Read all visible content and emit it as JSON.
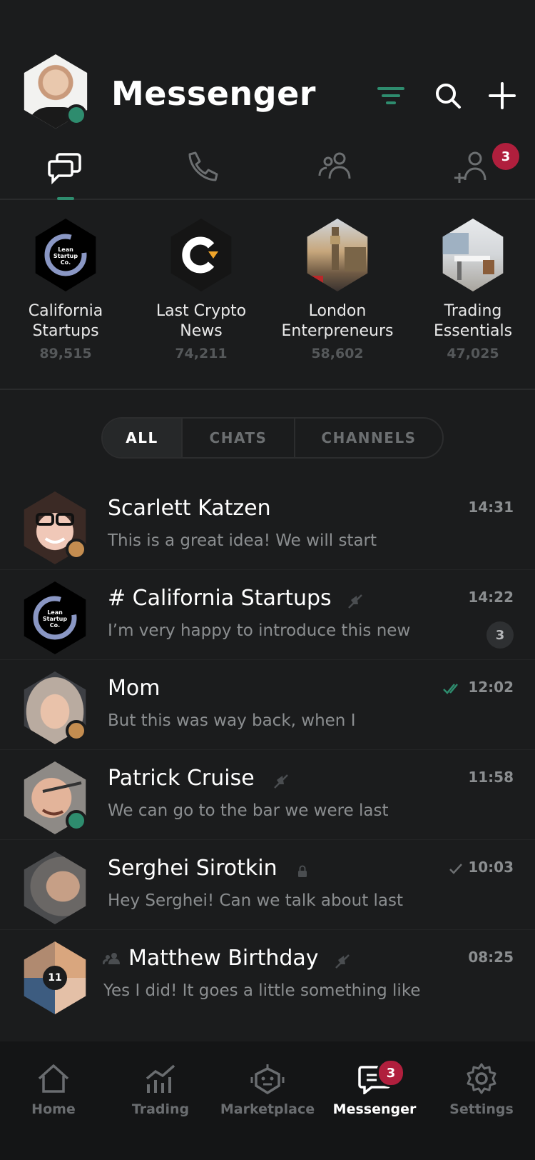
{
  "header": {
    "title": "Messenger",
    "contacts_badge": "3"
  },
  "featured": [
    {
      "name_line1": "California",
      "name_line2": "Startups",
      "count": "89,515"
    },
    {
      "name_line1": "Last Crypto",
      "name_line2": "News",
      "count": "74,211"
    },
    {
      "name_line1": "London",
      "name_line2": "Enterpreneurs",
      "count": "58,602"
    },
    {
      "name_line1": "Trading",
      "name_line2": "Essentials",
      "count": "47,025"
    }
  ],
  "filter_tabs": {
    "all": "ALL",
    "chats": "CHATS",
    "channels": "CHANNELS",
    "selected": "ALL"
  },
  "chats": [
    {
      "name": "Scarlett Katzen",
      "message": "This is a great idea! We will start",
      "time": "14:31"
    },
    {
      "name": "# California Startups",
      "message": "I’m very happy to introduce this new",
      "time": "14:22",
      "unread": "3"
    },
    {
      "name": "Mom",
      "message": "But this was way back, when I",
      "time": "12:02"
    },
    {
      "name": "Patrick Cruise",
      "message": "We can go to the bar we were last",
      "time": "11:58"
    },
    {
      "name": "Serghei Sirotkin",
      "message": "Hey Serghei! Can we talk about last",
      "time": "10:03"
    },
    {
      "name": "Matthew Birthday",
      "message": "Yes I did! It goes a little something like",
      "time": "08:25",
      "members": "11"
    }
  ],
  "nav": {
    "home": "Home",
    "trading": "Trading",
    "marketplace": "Marketplace",
    "messenger": "Messenger",
    "settings": "Settings",
    "messenger_badge": "3"
  },
  "colors": {
    "accent": "#2e8c6e",
    "badge": "#b01f3d",
    "background": "#1b1c1d"
  }
}
